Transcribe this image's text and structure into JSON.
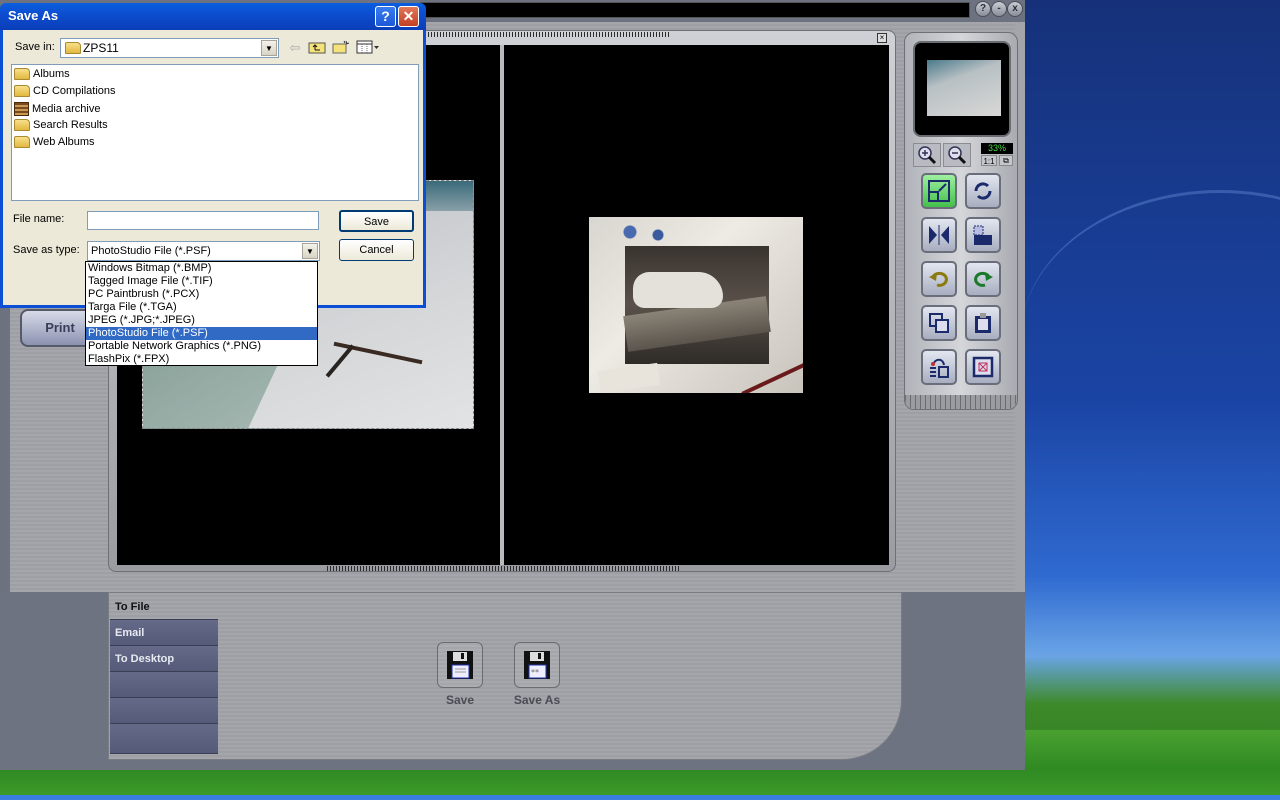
{
  "desktop": {
    "taskbar_color": "#3a7ee0"
  },
  "app": {
    "window_controls": {
      "help": "?",
      "minimize": "-",
      "close": "x"
    },
    "print_button": "Print",
    "preview_close": "×",
    "navigator": {
      "zoom_level": "33%",
      "one_to_one": "1:1",
      "fit_window": "⧉"
    },
    "tools": [
      {
        "name": "resize",
        "active": true
      },
      {
        "name": "rotate",
        "active": false
      },
      {
        "name": "flip",
        "active": false
      },
      {
        "name": "crop",
        "active": false
      },
      {
        "name": "undo",
        "active": false
      },
      {
        "name": "redo",
        "active": false
      },
      {
        "name": "duplicate",
        "active": false
      },
      {
        "name": "paste",
        "active": false
      },
      {
        "name": "transfer",
        "active": false
      },
      {
        "name": "delete-frame",
        "active": false
      }
    ],
    "bottom": {
      "tabs": [
        {
          "label": "To File",
          "active": true
        },
        {
          "label": "Email",
          "active": false
        },
        {
          "label": "To Desktop",
          "active": false
        },
        {
          "label": "",
          "active": false
        },
        {
          "label": "",
          "active": false
        },
        {
          "label": "",
          "active": false
        }
      ],
      "actions": [
        {
          "label": "Save"
        },
        {
          "label": "Save As"
        }
      ]
    }
  },
  "dialog": {
    "title": "Save As",
    "help_button": "?",
    "close_button": "✕",
    "save_in_label": "Save in:",
    "save_in_value": "ZPS11",
    "files": [
      {
        "name": "Albums",
        "icon": "folder"
      },
      {
        "name": "CD Compilations",
        "icon": "folder"
      },
      {
        "name": "Media archive",
        "icon": "archive"
      },
      {
        "name": "Search Results",
        "icon": "folder"
      },
      {
        "name": "Web Albums",
        "icon": "folder"
      }
    ],
    "file_name_label": "File name:",
    "file_name_value": "",
    "save_as_type_label": "Save as type:",
    "save_as_type_value": "PhotoStudio File (*.PSF)",
    "save_button": "Save",
    "cancel_button": "Cancel",
    "type_options": [
      {
        "label": "Windows Bitmap (*.BMP)",
        "selected": false
      },
      {
        "label": "Tagged Image File (*.TIF)",
        "selected": false
      },
      {
        "label": "PC Paintbrush (*.PCX)",
        "selected": false
      },
      {
        "label": "Targa File (*.TGA)",
        "selected": false
      },
      {
        "label": "JPEG (*.JPG;*.JPEG)",
        "selected": false
      },
      {
        "label": "PhotoStudio File (*.PSF)",
        "selected": true
      },
      {
        "label": "Portable Network Graphics (*.PNG)",
        "selected": false
      },
      {
        "label": "FlashPix (*.FPX)",
        "selected": false
      }
    ]
  }
}
